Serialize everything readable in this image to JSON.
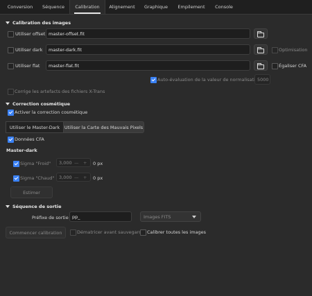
{
  "tabs": [
    "Conversion",
    "Séquence",
    "Calibration",
    "Alignement",
    "Graphique",
    "Empilement",
    "Console"
  ],
  "calib_images": {
    "title": "Calibration des images",
    "offset_label": "Utiliser offset",
    "offset_file": "master-offset.fit",
    "dark_label": "Utiliser dark",
    "dark_file": "master-dark.fit",
    "flat_label": "Utiliser flat",
    "flat_file": "master-flat.fit",
    "optimisation": "Optimisation",
    "egaliser_cfa": "Égaliser CFA",
    "auto_eval": "Auto-évaluation de la valeur de normalisation",
    "norm_value": "5000",
    "xtrans": "Corrige les artefacts des fichiers X-Trans"
  },
  "cosmetic": {
    "title": "Correction cosmétique",
    "activate": "Activer la correction cosmétique",
    "use_master_dark": "Utiliser le Master-Dark",
    "use_bad_pixels": "Utiliser la Carte des Mauvais Pixels",
    "cfa_data": "Données CFA",
    "master_dark_title": "Master-dark",
    "cold_label": "Sigma \"Froid\"",
    "cold_value": "3,000",
    "cold_px": "0 px",
    "hot_label": "Sigma \"Chaud\"",
    "hot_value": "3,000",
    "hot_px": "0 px",
    "estimate": "Estimer"
  },
  "output": {
    "title": "Séquence de sortie",
    "prefix_label": "Préfixe de sortie :",
    "prefix_value": "pp_",
    "format": "Images FITS",
    "start": "Commencer calibration",
    "debayer": "Dématricer avant sauvegarde",
    "calibrate_all": "Calibrer toutes les images"
  },
  "colors": {
    "accent": "#3b82f6",
    "background": "#2b2b2b"
  }
}
